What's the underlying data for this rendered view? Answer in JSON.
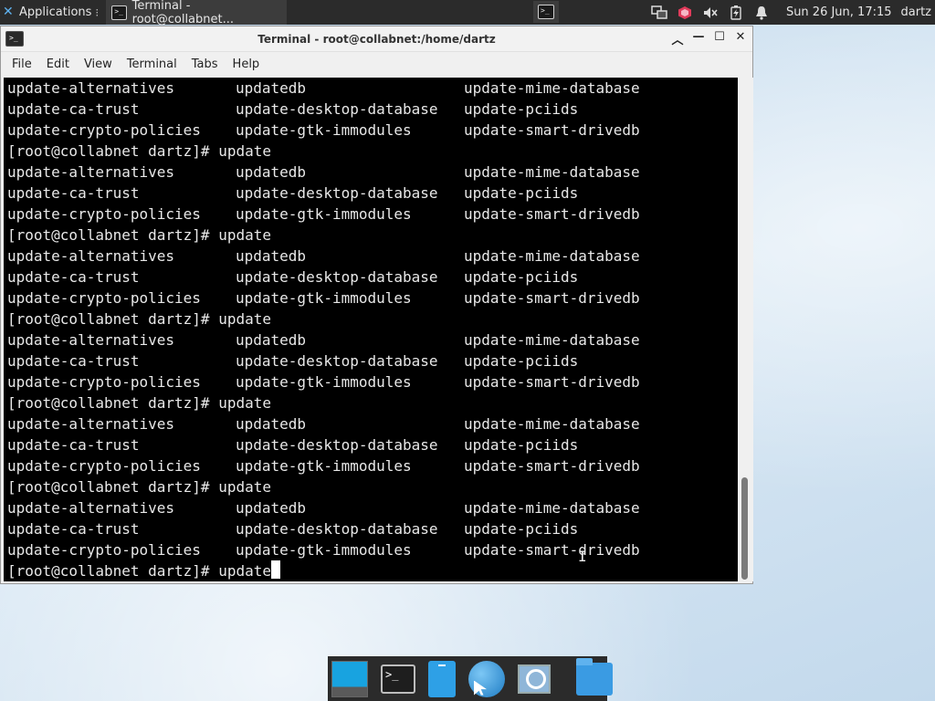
{
  "top_panel": {
    "applications_label": "Applications",
    "task_label": "Terminal - root@collabnet...",
    "clock": "Sun 26 Jun, 17:15",
    "user": "dartz"
  },
  "window": {
    "title": "Terminal - root@collabnet:/home/dartz",
    "menu": [
      "File",
      "Edit",
      "View",
      "Terminal",
      "Tabs",
      "Help"
    ]
  },
  "terminal": {
    "prompt": "[root@collabnet dartz]# ",
    "command": "update",
    "completions": [
      [
        "update-alternatives",
        "updatedb",
        "update-mime-database"
      ],
      [
        "update-ca-trust",
        "update-desktop-database",
        "update-pciids"
      ],
      [
        "update-crypto-policies",
        "update-gtk-immodules",
        "update-smart-drivedb"
      ]
    ],
    "lines": [
      {
        "type": "row",
        "cols": [
          "update-alternatives",
          "updatedb",
          "update-mime-database"
        ]
      },
      {
        "type": "row",
        "cols": [
          "update-ca-trust",
          "update-desktop-database",
          "update-pciids"
        ]
      },
      {
        "type": "row",
        "cols": [
          "update-crypto-policies",
          "update-gtk-immodules",
          "update-smart-drivedb"
        ]
      },
      {
        "type": "prompt",
        "text": "[root@collabnet dartz]# update"
      },
      {
        "type": "row",
        "cols": [
          "update-alternatives",
          "updatedb",
          "update-mime-database"
        ]
      },
      {
        "type": "row",
        "cols": [
          "update-ca-trust",
          "update-desktop-database",
          "update-pciids"
        ]
      },
      {
        "type": "row",
        "cols": [
          "update-crypto-policies",
          "update-gtk-immodules",
          "update-smart-drivedb"
        ]
      },
      {
        "type": "prompt",
        "text": "[root@collabnet dartz]# update"
      },
      {
        "type": "row",
        "cols": [
          "update-alternatives",
          "updatedb",
          "update-mime-database"
        ]
      },
      {
        "type": "row",
        "cols": [
          "update-ca-trust",
          "update-desktop-database",
          "update-pciids"
        ]
      },
      {
        "type": "row",
        "cols": [
          "update-crypto-policies",
          "update-gtk-immodules",
          "update-smart-drivedb"
        ]
      },
      {
        "type": "prompt",
        "text": "[root@collabnet dartz]# update"
      },
      {
        "type": "row",
        "cols": [
          "update-alternatives",
          "updatedb",
          "update-mime-database"
        ]
      },
      {
        "type": "row",
        "cols": [
          "update-ca-trust",
          "update-desktop-database",
          "update-pciids"
        ]
      },
      {
        "type": "row",
        "cols": [
          "update-crypto-policies",
          "update-gtk-immodules",
          "update-smart-drivedb"
        ]
      },
      {
        "type": "prompt",
        "text": "[root@collabnet dartz]# update"
      },
      {
        "type": "row",
        "cols": [
          "update-alternatives",
          "updatedb",
          "update-mime-database"
        ]
      },
      {
        "type": "row",
        "cols": [
          "update-ca-trust",
          "update-desktop-database",
          "update-pciids"
        ]
      },
      {
        "type": "row",
        "cols": [
          "update-crypto-policies",
          "update-gtk-immodules",
          "update-smart-drivedb"
        ]
      },
      {
        "type": "prompt",
        "text": "[root@collabnet dartz]# update"
      },
      {
        "type": "row",
        "cols": [
          "update-alternatives",
          "updatedb",
          "update-mime-database"
        ]
      },
      {
        "type": "row",
        "cols": [
          "update-ca-trust",
          "update-desktop-database",
          "update-pciids"
        ]
      },
      {
        "type": "row",
        "cols": [
          "update-crypto-policies",
          "update-gtk-immodules",
          "update-smart-drivedb"
        ]
      },
      {
        "type": "current",
        "text": "[root@collabnet dartz]# update"
      }
    ]
  },
  "tray_icons": [
    "network-icon",
    "package-updates-icon",
    "volume-muted-icon",
    "battery-charging-icon",
    "notification-bell-icon"
  ],
  "dock_items": [
    "show-desktop-icon",
    "terminal-icon",
    "phone-icon",
    "web-browser-icon",
    "app-finder-icon",
    "file-manager-icon"
  ]
}
